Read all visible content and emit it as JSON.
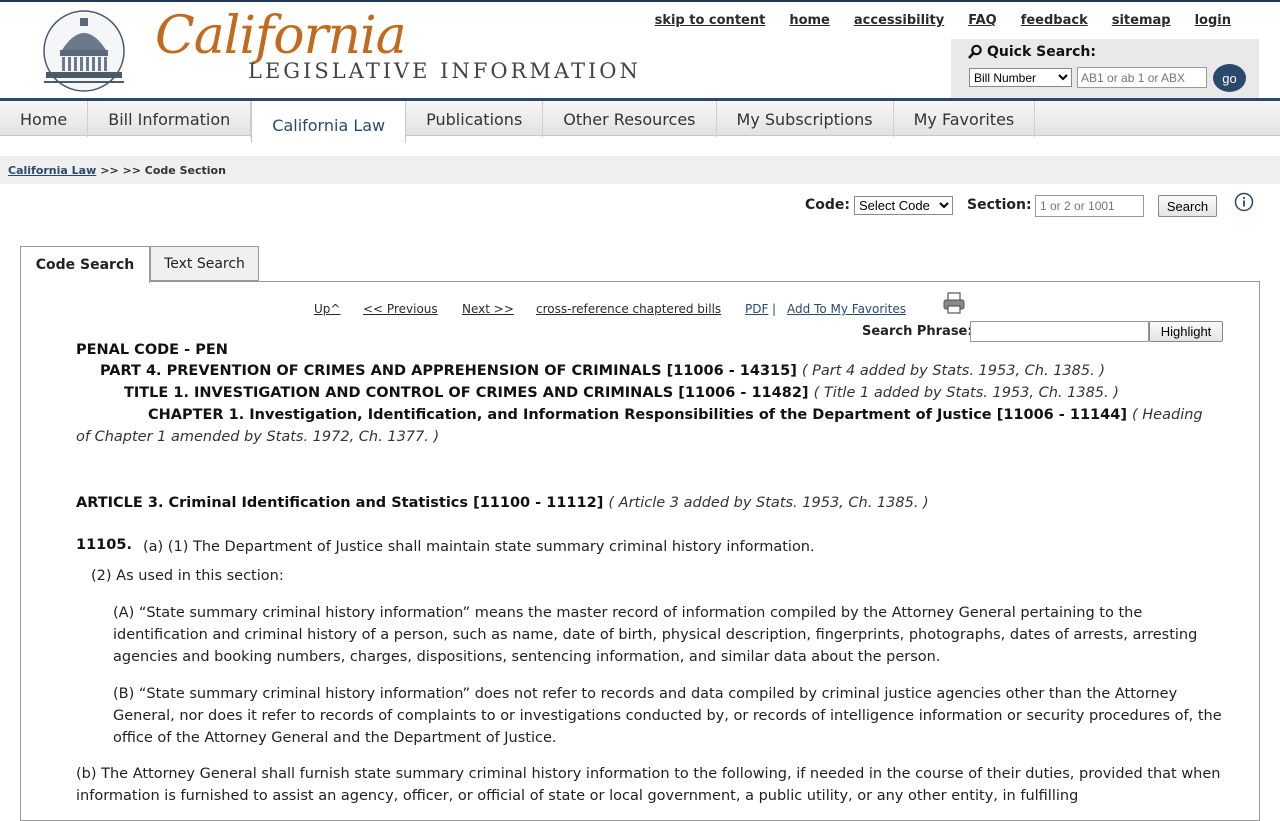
{
  "header": {
    "logo_script": "California",
    "logo_sub": "LEGISLATIVE INFORMATION",
    "top_links": [
      "skip to content",
      "home",
      "accessibility",
      "FAQ",
      "feedback",
      "sitemap",
      "login"
    ],
    "quick_search": {
      "title": "Quick Search:",
      "select_value": "Bill Number",
      "placeholder": "AB1 or ab 1 or ABX",
      "go_label": "go"
    }
  },
  "nav": {
    "tabs": [
      "Home",
      "Bill Information",
      "California Law",
      "Publications",
      "Other Resources",
      "My Subscriptions",
      "My Favorites"
    ],
    "active": "California Law"
  },
  "breadcrumb": {
    "link": "California Law",
    "rest": ">> >> Code Section"
  },
  "code_search": {
    "code_label": "Code:",
    "code_select": "Select Code",
    "section_label": "Section:",
    "section_placeholder": "1 or 2 or 1001",
    "search_button": "Search"
  },
  "tabs": {
    "code_search": "Code Search",
    "text_search": "Text Search"
  },
  "toolbar": {
    "up": "Up^",
    "previous": "<< Previous",
    "next": "Next >>",
    "cross_ref": "cross-reference chaptered bills",
    "pdf": "PDF",
    "sep": "|",
    "favorites": "Add To My Favorites",
    "phrase_label": "Search Phrase:",
    "highlight_button": "Highlight"
  },
  "document": {
    "code": "PENAL CODE - PEN",
    "part": "PART 4. PREVENTION OF CRIMES AND APPREHENSION OF CRIMINALS [11006 - 14315]",
    "part_note": "( Part 4 added by Stats. 1953, Ch. 1385. )",
    "title": "TITLE 1. INVESTIGATION AND CONTROL OF CRIMES AND CRIMINALS [11006 - 11482]",
    "title_note": "( Title 1 added by Stats. 1953, Ch. 1385. )",
    "chapter": "CHAPTER 1. Investigation, Identification, and Information Responsibilities of the Department of Justice [11006 - 11144]",
    "chapter_note_1": "( Heading",
    "chapter_note_2": "of Chapter 1 amended by Stats. 1972, Ch. 1377. )",
    "article": "ARTICLE 3. Criminal Identification and Statistics [11100 - 11112]",
    "article_note": "( Article 3 added by Stats. 1953, Ch. 1385. )",
    "section_number": "11105.",
    "a1": "(a) (1) The Department of Justice shall maintain state summary criminal history information.",
    "a2": "(2) As used in this section:",
    "A_text": "(A) “State summary criminal history information” means the master record of information compiled by the Attorney General pertaining to the identification and criminal history of a person, such as name, date of birth, physical description, fingerprints, photographs, dates of arrests, arresting agencies and booking numbers, charges, dispositions, sentencing information, and similar data about the person.",
    "B_text": "(B) “State summary criminal history information” does not refer to records and data compiled by criminal justice agencies other than the Attorney General, nor does it refer to records of complaints to or investigations conducted by, or records of intelligence information or security procedures of, the office of the Attorney General and the Department of Justice.",
    "b_text": "(b) The Attorney General shall furnish state summary criminal history information to the following, if needed in the course of their duties, provided that when information is furnished to assist an agency, officer, or official of state or local government, a public utility, or any other entity, in fulfilling"
  }
}
